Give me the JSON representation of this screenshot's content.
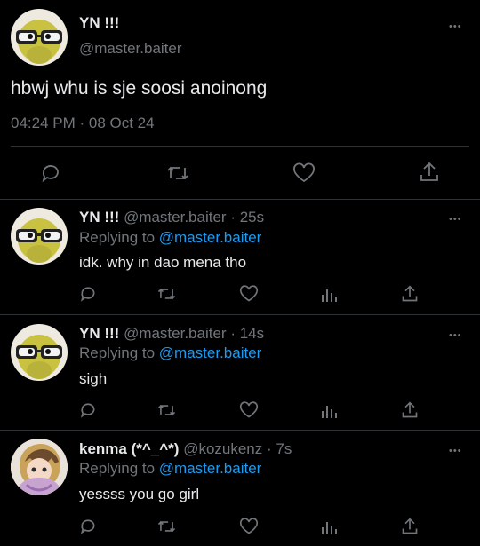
{
  "main_tweet": {
    "display_name": "YN !!!",
    "handle": "@master.baiter",
    "text": "hbwj whu is sje soosi anoinong",
    "timestamp": "04:24 PM · 08 Oct 24",
    "more_label": "•••"
  },
  "replies": [
    {
      "display_name": "YN !!!",
      "handle": "@master.baiter",
      "age": "· 25s",
      "replying_label": "Replying to",
      "replying_to": "@master.baiter",
      "text": "idk. why in dao mena tho",
      "more_label": "•••"
    },
    {
      "display_name": "YN !!!",
      "handle": "@master.baiter",
      "age": "· 14s",
      "replying_label": "Replying to",
      "replying_to": "@master.baiter",
      "text": "sigh",
      "more_label": "•••"
    },
    {
      "display_name": "kenma (*^_^*)",
      "handle": "@kozukenz",
      "age": "· 7s",
      "replying_label": "Replying to",
      "replying_to": "@master.baiter",
      "text": "yessss you go girl",
      "more_label": "•••"
    }
  ],
  "icons": [
    "reply-icon",
    "retweet-icon",
    "like-icon",
    "analytics-icon",
    "share-icon"
  ],
  "colors": {
    "background": "#000000",
    "text": "#e7e9ea",
    "muted": "#71767b",
    "link": "#1d9bf0",
    "divider": "#2f3336"
  }
}
